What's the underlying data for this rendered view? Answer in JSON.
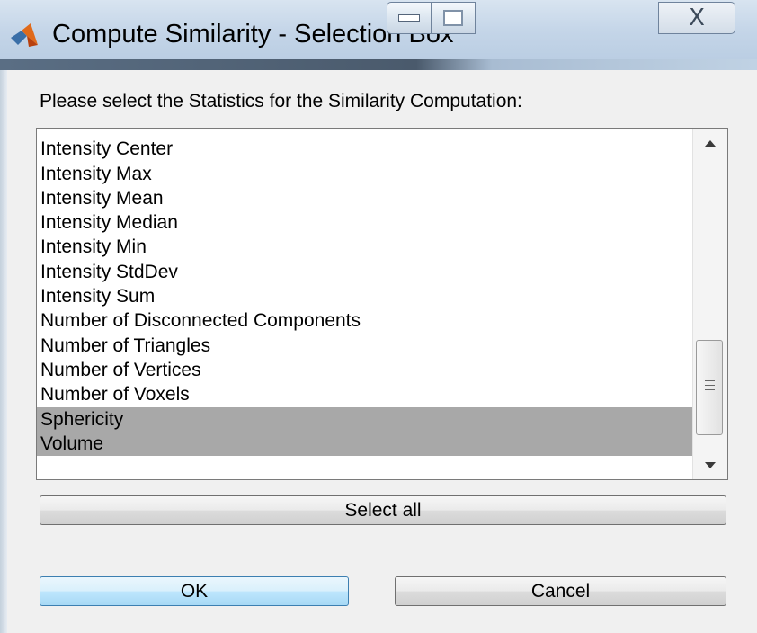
{
  "window": {
    "title": "Compute Similarity - Selection Box",
    "close_glyph": "X"
  },
  "dialog": {
    "prompt": "Please select the Statistics for the Similarity Computation:"
  },
  "list": {
    "items": [
      {
        "label": "Intensity Center",
        "selected": false
      },
      {
        "label": "Intensity Max",
        "selected": false
      },
      {
        "label": "Intensity Mean",
        "selected": false
      },
      {
        "label": "Intensity Median",
        "selected": false
      },
      {
        "label": "Intensity Min",
        "selected": false
      },
      {
        "label": "Intensity StdDev",
        "selected": false
      },
      {
        "label": "Intensity Sum",
        "selected": false
      },
      {
        "label": "Number of Disconnected Components",
        "selected": false
      },
      {
        "label": "Number of Triangles",
        "selected": false
      },
      {
        "label": "Number of Vertices",
        "selected": false
      },
      {
        "label": "Number of Voxels",
        "selected": false
      },
      {
        "label": "Sphericity",
        "selected": true
      },
      {
        "label": "Volume",
        "selected": true
      }
    ],
    "selection_color": "#a8a8a8"
  },
  "buttons": {
    "select_all": "Select all",
    "ok": "OK",
    "cancel": "Cancel"
  }
}
